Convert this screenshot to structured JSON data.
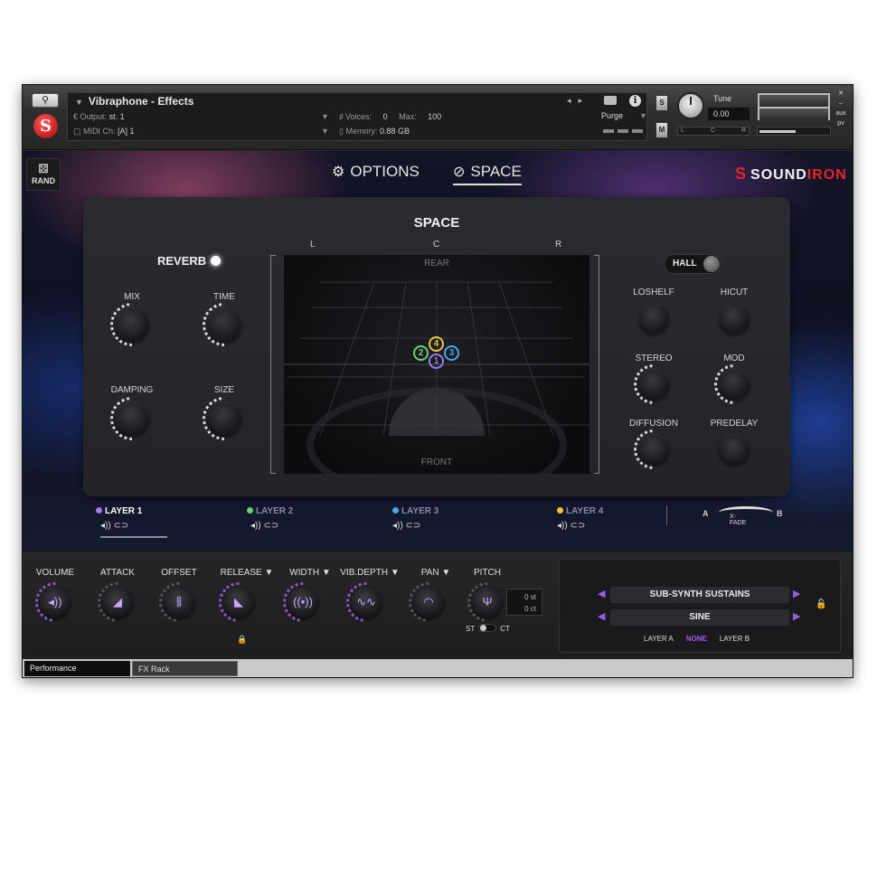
{
  "header": {
    "instrument_name": "Vibraphone - Effects",
    "output_label": "Output:",
    "output_value": "st. 1",
    "voices_label": "Voices:",
    "voices_value": "0",
    "max_label": "Max:",
    "max_value": "100",
    "midi_label": "MIDI Ch:",
    "midi_value": "[A]  1",
    "memory_label": "Memory:",
    "memory_value": "0.88 GB",
    "purge_label": "Purge",
    "solo_label": "S",
    "mute_label": "M",
    "tune_label": "Tune",
    "tune_value": "0.00",
    "pan_l": "L",
    "pan_c": "C",
    "pan_r": "R",
    "aux_label": "aux",
    "pv_label": "pv"
  },
  "nav": {
    "rand_label": "RAND",
    "options_label": "OPTIONS",
    "space_label": "SPACE",
    "brand_sound": "SOUND",
    "brand_iron": "IRON"
  },
  "space_panel": {
    "title": "SPACE",
    "lcr": [
      "L",
      "C",
      "R"
    ],
    "reverb_label": "REVERB",
    "left_knobs": [
      "MIX",
      "TIME",
      "DAMPING",
      "SIZE"
    ],
    "grid_rear": "REAR",
    "grid_front": "FRONT",
    "markers": [
      "4",
      "2",
      "3",
      "1"
    ],
    "hall_label": "HALL",
    "right_knobs": [
      "LOSHELF",
      "HICUT",
      "STEREO",
      "MOD",
      "DIFFUSION",
      "PREDELAY"
    ]
  },
  "layers": [
    {
      "label": "LAYER 1",
      "color": "#9b7bf0"
    },
    {
      "label": "LAYER 2",
      "color": "#6fcf6f"
    },
    {
      "label": "LAYER 3",
      "color": "#4aa8e8"
    },
    {
      "label": "LAYER 4",
      "color": "#f0c24a"
    }
  ],
  "xfade": {
    "a": "A",
    "b": "B",
    "label": "X-FADE"
  },
  "controls": {
    "volume": "VOLUME",
    "attack": "ATTACK",
    "offset": "OFFSET",
    "release": "RELEASE ▼",
    "width": "WIDTH ▼",
    "vib_depth": "VIB.DEPTH ▼",
    "pan": "PAN  ▼",
    "pitch": "PITCH",
    "pitch_st": "0 st",
    "pitch_ct": "0 ct",
    "st_label": "ST",
    "ct_label": "CT"
  },
  "preset": {
    "row1": "SUB-SYNTH SUSTAINS",
    "row2": "SINE",
    "layer_a": "LAYER A",
    "none": "NONE",
    "layer_b": "LAYER B"
  },
  "footer": {
    "tab1": "Performance",
    "tab2": "FX Rack"
  },
  "colors": {
    "accent": "#9b5de5",
    "brand_red": "#e6262a",
    "marker_4": "#f0c24a",
    "marker_2": "#6fcf6f",
    "marker_3": "#4aa8e8",
    "marker_1": "#9b7bf0"
  }
}
